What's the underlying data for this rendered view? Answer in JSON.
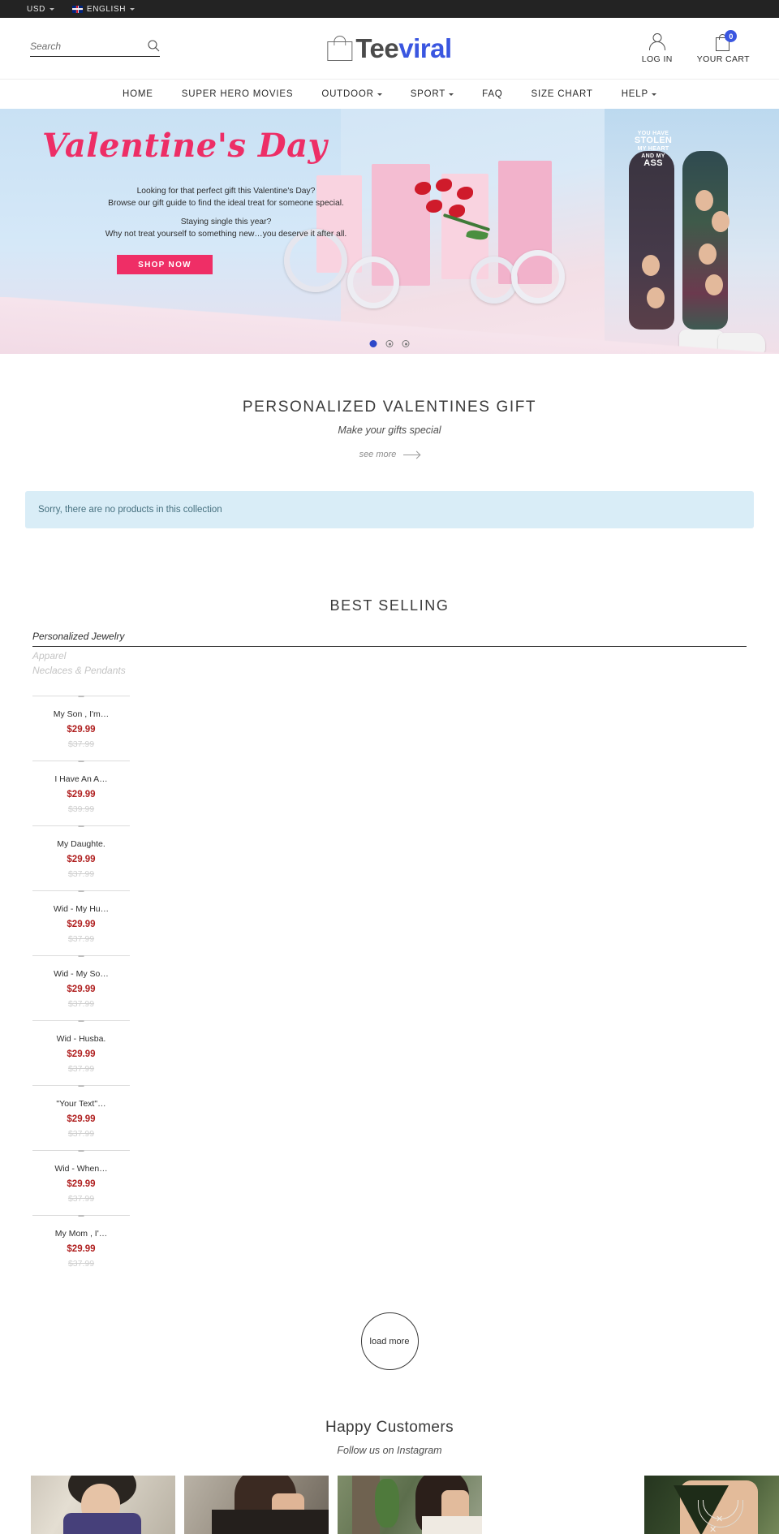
{
  "topbar": {
    "currency": "USD",
    "language": "ENGLISH",
    "flag_icon": "uk-flag-icon"
  },
  "header": {
    "search_placeholder": "Search",
    "search_value": "",
    "search_icon": "search-icon",
    "logo": {
      "part1": "Tee",
      "part2": "viral",
      "icon": "shopping-bag-icon"
    },
    "account": {
      "label": "LOG IN",
      "icon": "person-icon"
    },
    "cart": {
      "label": "YOUR CART",
      "icon": "cart-bag-icon",
      "count": "0",
      "badge_color": "#3a56e0"
    }
  },
  "nav": {
    "items": [
      {
        "label": "HOME",
        "has_dropdown": false
      },
      {
        "label": "SUPER HERO MOVIES",
        "has_dropdown": false
      },
      {
        "label": "OUTDOOR",
        "has_dropdown": true
      },
      {
        "label": "SPORT",
        "has_dropdown": true
      },
      {
        "label": "FAQ",
        "has_dropdown": false
      },
      {
        "label": "SIZE CHART",
        "has_dropdown": false
      },
      {
        "label": "HELP",
        "has_dropdown": true
      }
    ]
  },
  "hero": {
    "title": "Valentine's Day",
    "line1": "Looking for that perfect gift this Valentine's Day?",
    "line2": "Browse our gift guide to find the ideal treat for someone special.",
    "line3": "Staying single this year?",
    "line4": "Why not treat yourself to something new…you deserve it after all.",
    "cta": "SHOP NOW",
    "cta_color": "#ef2e66",
    "title_color": "#ed2e66",
    "legging_text_1": "YOU HAVE",
    "legging_text_2": "STOLEN",
    "legging_text_3": "MY HEART",
    "legging_text_4": "AND MY",
    "legging_text_5": "ASS",
    "slides": [
      "1",
      "2",
      "3"
    ],
    "active_slide": 0
  },
  "promo": {
    "title": "PERSONALIZED VALENTINES GIFT",
    "subtitle": "Make your gifts special",
    "see_more": "see more",
    "empty_message": "Sorry, there are no products in this collection",
    "empty_bg": "#d9edf7"
  },
  "bestselling": {
    "title": "BEST SELLING",
    "tabs": [
      {
        "label": "Personalized Jewelry",
        "active": true
      },
      {
        "label": "Apparel",
        "active": false
      },
      {
        "label": "Neclaces & Pendants",
        "active": false
      }
    ],
    "products": [
      {
        "title": "My Son , I'm…",
        "sale_price": "$29.99",
        "original_price": "$37.99"
      },
      {
        "title": "I Have An A…",
        "sale_price": "$29.99",
        "original_price": "$39.99"
      },
      {
        "title": "My Daughte.",
        "sale_price": "$29.99",
        "original_price": "$37.99"
      },
      {
        "title": "Wid - My Hu…",
        "sale_price": "$29.99",
        "original_price": "$37.99"
      },
      {
        "title": "Wid - My So…",
        "sale_price": "$29.99",
        "original_price": "$37.99"
      },
      {
        "title": "Wid - Husba.",
        "sale_price": "$29.99",
        "original_price": "$37.99"
      },
      {
        "title": "\"Your Text\"…",
        "sale_price": "$29.99",
        "original_price": "$37.99"
      },
      {
        "title": "Wid - When…",
        "sale_price": "$29.99",
        "original_price": "$37.99"
      },
      {
        "title": "My Mom , I'…",
        "sale_price": "$29.99",
        "original_price": "$37.99"
      }
    ],
    "load_more": "load more",
    "sale_price_color": "#b02020"
  },
  "happy": {
    "title": "Happy Customers",
    "subtitle": "Follow us on Instagram",
    "photos": [
      "woman-in-hat",
      "woman-dark-hair",
      "woman-outdoors",
      "necklace-closeup"
    ]
  }
}
